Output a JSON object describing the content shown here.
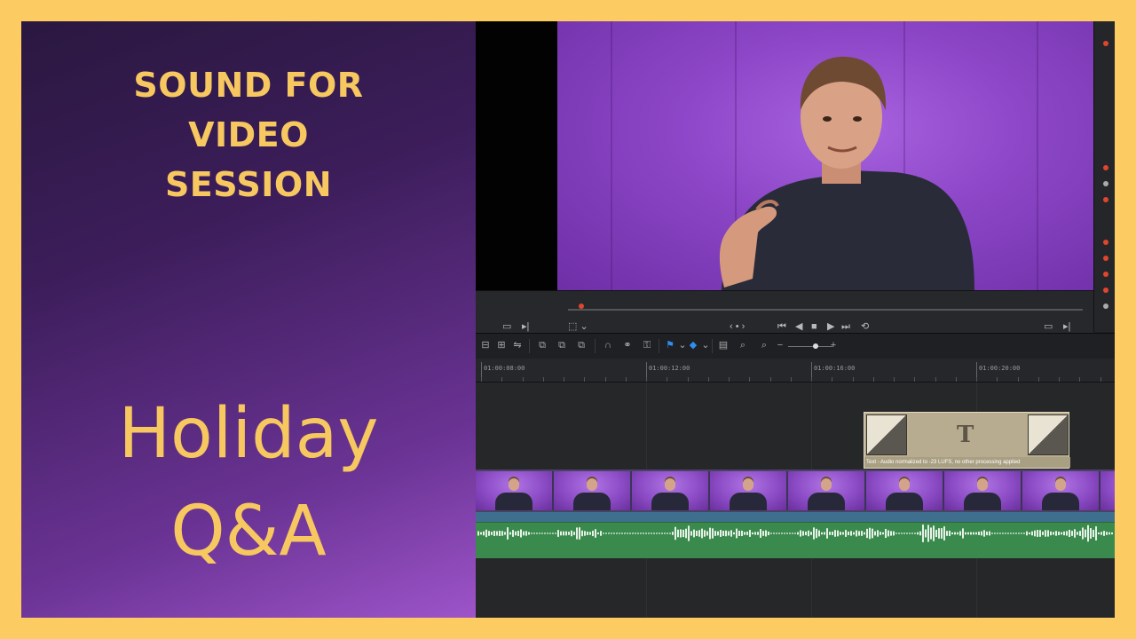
{
  "thumbnail": {
    "session_lines": [
      "SOUND FOR",
      "VIDEO",
      "SESSION"
    ],
    "title_lines": [
      "Holiday",
      "Q&A"
    ]
  },
  "colors": {
    "frame": "#FCCB62",
    "accent_text": "#F7C760",
    "panel_dark": "#2a1840",
    "panel_light": "#9d54c9",
    "title_clip": "#b7ac8f",
    "audio_clip": "#3b8a4d",
    "video_clip_bar": "#3f6f8f",
    "playhead": "#e0462e"
  },
  "editor": {
    "timecodes": [
      "01:00:08:00",
      "01:00:12:00",
      "01:00:16:00",
      "01:00:20:00"
    ],
    "title_clip": {
      "glyph": "T",
      "label": "Text - Audio normalized to -23 LUFS, no other processing applied"
    },
    "transport_icons": [
      "jump-start-icon",
      "play-reverse-icon",
      "stop-icon",
      "play-icon",
      "jump-end-icon",
      "loop-icon"
    ],
    "toolbar_icons": [
      "trim-icon",
      "blade-icon",
      "dynamic-trim-icon",
      "insert-icon",
      "overwrite-icon",
      "replace-icon",
      "snapping-icon",
      "link-icon",
      "lock-icon",
      "flag-icon",
      "marker-icon",
      "zoom-full-icon",
      "zoom-detail-icon",
      "zoom-custom-icon"
    ],
    "transport_glyphs": {
      "prev": "⏮",
      "rev": "◀",
      "stop": "■",
      "play": "▶",
      "next": "⏭",
      "loop": "⟲",
      "nav": "‹ • ›"
    }
  }
}
